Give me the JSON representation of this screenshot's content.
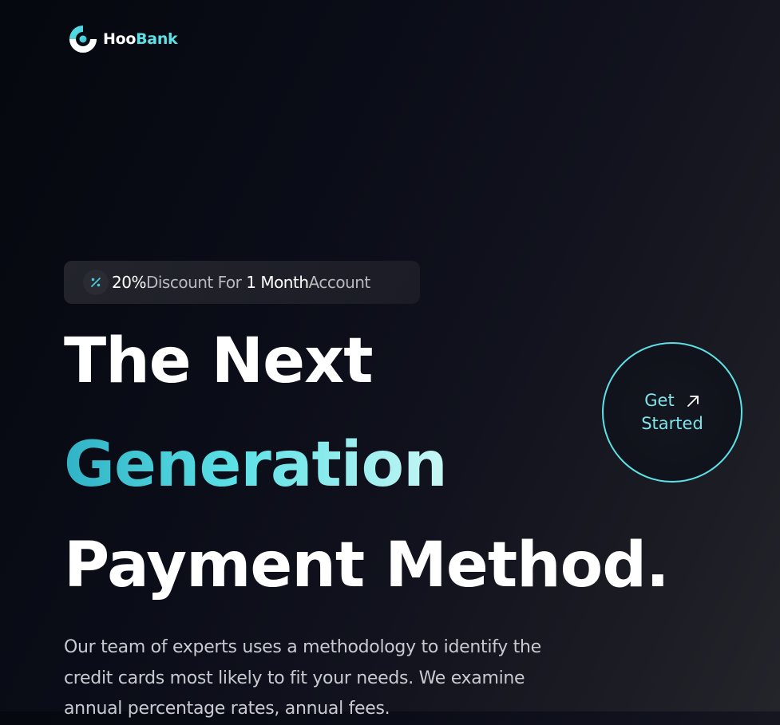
{
  "brand": {
    "name_part1": "Hoo",
    "name_part2": "Bank",
    "accent_color": "#5ce1e6"
  },
  "promo": {
    "icon": "discount-icon",
    "highlight_value": "20%",
    "text_1": "Discount For",
    "highlight_period": "1 Month",
    "text_2": "Account"
  },
  "hero": {
    "line1": "The Next",
    "line2": "Generation",
    "line3": "Payment Method."
  },
  "cta": {
    "label_line1": "Get",
    "label_line2": "Started",
    "icon": "arrow-up-right-icon"
  },
  "description": {
    "text": "Our team of experts uses a methodology to identify the credit cards most likely to fit your needs. We examine annual percentage rates, annual fees."
  }
}
